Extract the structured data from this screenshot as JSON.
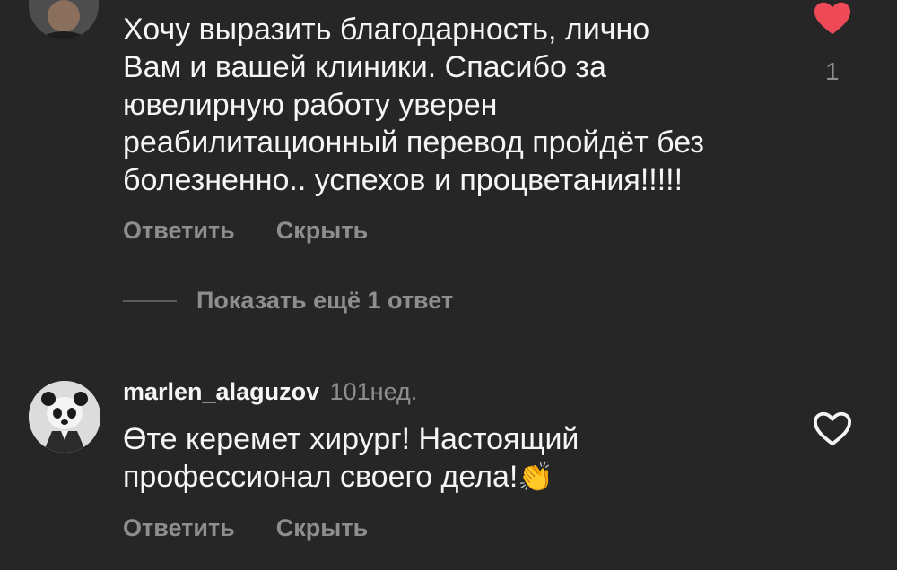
{
  "comment1": {
    "text": "Хочу выразить благодарность, лично\nВам и вашей клиники. Спасибо за\nювелирную работу уверен\nреабилитационный перевод пройдёт без\nболезненно.. успехов и процветания!!!!!",
    "like_count": "1",
    "liked": true,
    "reply_label": "Ответить",
    "hide_label": "Скрыть"
  },
  "show_more": {
    "label": "Показать ещё 1 ответ"
  },
  "comment2": {
    "username": "marlen_alaguzov",
    "time": "101нед.",
    "text": "Өте керемет хирург! Настоящий\nпрофессионал своего дела!",
    "emoji": "👏",
    "liked": false,
    "reply_label": "Ответить",
    "hide_label": "Скрыть"
  },
  "colors": {
    "background": "#262626",
    "text": "#f5f5f5",
    "secondary": "#8e8e8e",
    "like": "#ed4956"
  },
  "icons": [
    "heart-filled-icon",
    "heart-outline-icon"
  ]
}
